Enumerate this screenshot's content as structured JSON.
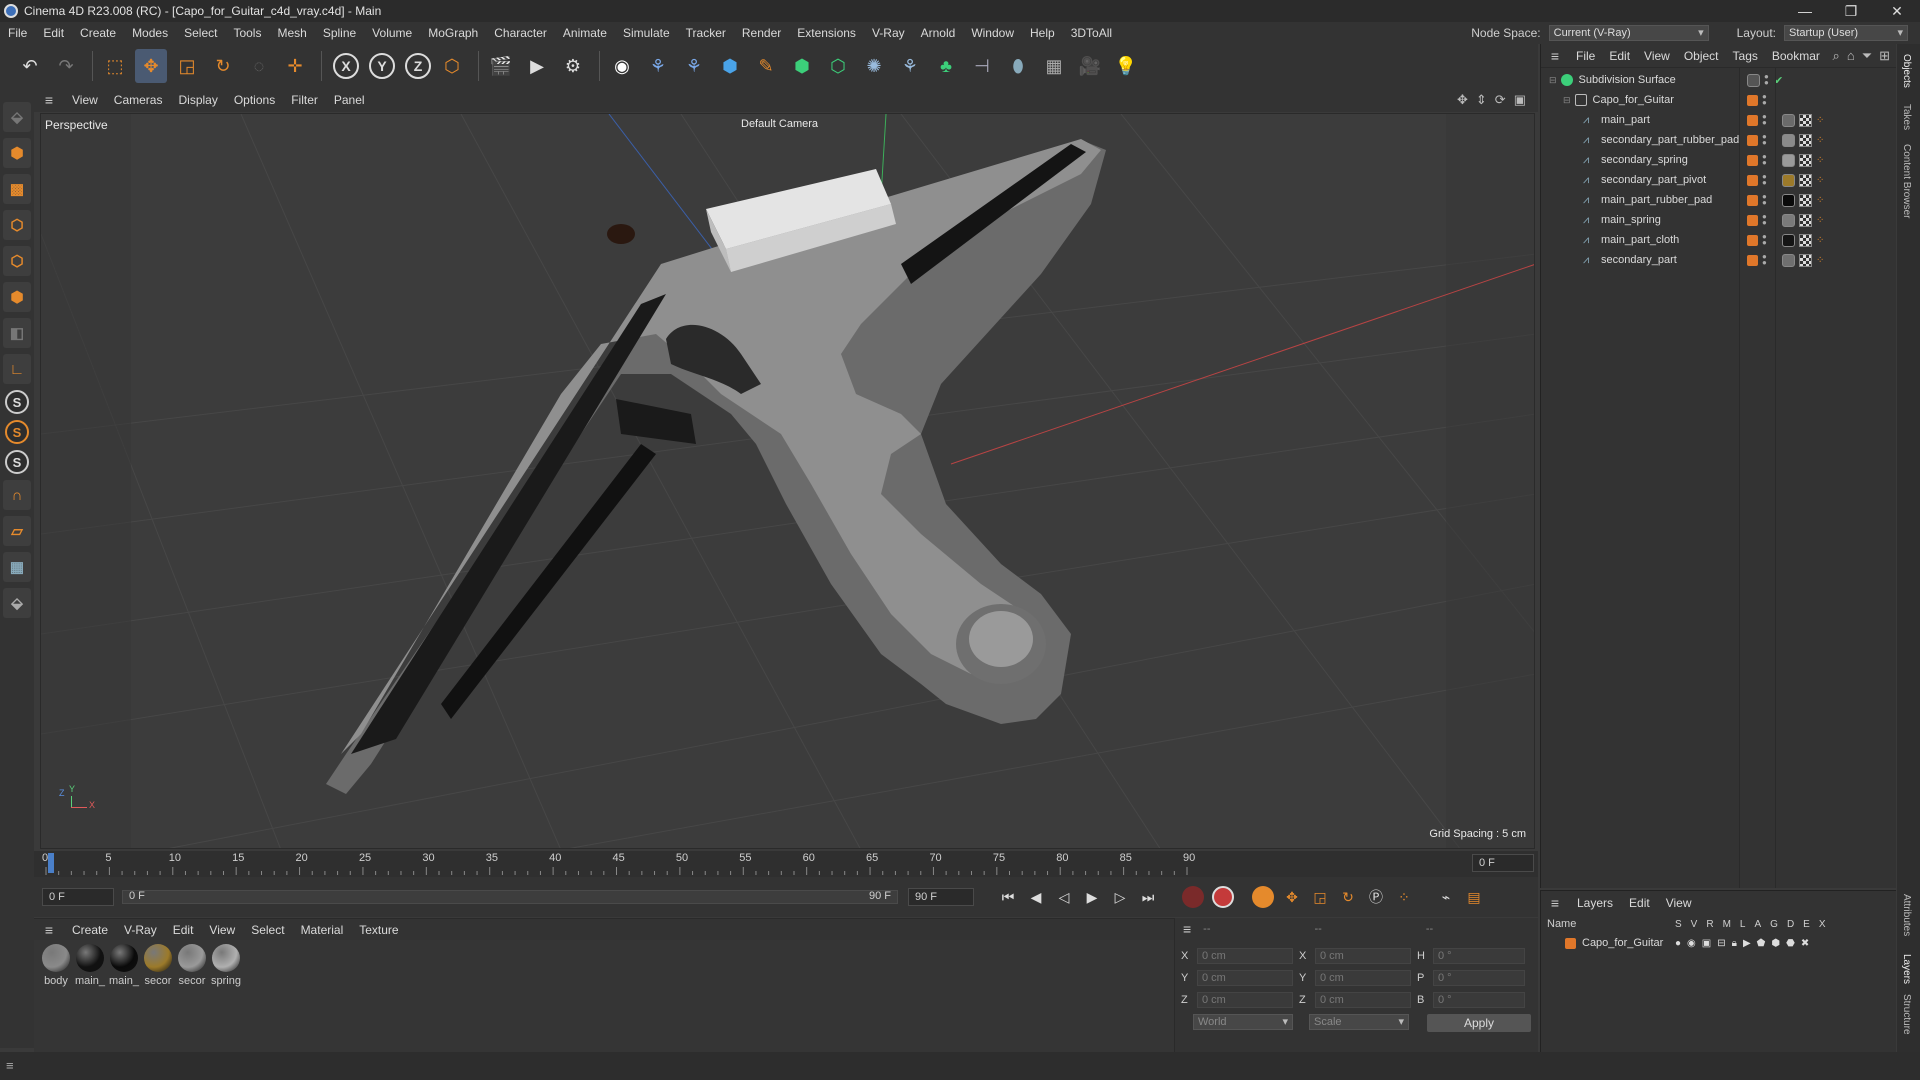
{
  "window": {
    "title": "Cinema 4D R23.008 (RC) - [Capo_for_Guitar_c4d_vray.c4d] - Main",
    "controls": [
      "—",
      "❐",
      "✕"
    ]
  },
  "menubar": {
    "items": [
      "File",
      "Edit",
      "Create",
      "Modes",
      "Select",
      "Tools",
      "Mesh",
      "Spline",
      "Volume",
      "MoGraph",
      "Character",
      "Animate",
      "Simulate",
      "Tracker",
      "Render",
      "Extensions",
      "V-Ray",
      "Arnold",
      "Window",
      "Help",
      "3DToAll"
    ],
    "node_space_label": "Node Space:",
    "node_space_value": "Current (V-Ray)",
    "layout_label": "Layout:",
    "layout_value": "Startup (User)"
  },
  "toolbar": {
    "x_label": "X",
    "y_label": "Y",
    "z_label": "Z"
  },
  "left_tools": {
    "s_label": "S"
  },
  "viewport": {
    "menu": [
      "View",
      "Cameras",
      "Display",
      "Options",
      "Filter",
      "Panel"
    ],
    "view_name": "Perspective",
    "camera_label": "Default Camera",
    "grid_spacing": "Grid Spacing : 5 cm",
    "axis_x": "X",
    "axis_y": "Y",
    "axis_z": "Z"
  },
  "timeline": {
    "ticks": [
      "0",
      "5",
      "10",
      "15",
      "20",
      "25",
      "30",
      "35",
      "40",
      "45",
      "50",
      "55",
      "60",
      "65",
      "70",
      "75",
      "80",
      "85",
      "90"
    ],
    "current_frame": "0 F"
  },
  "frame_controls": {
    "start": "0 F",
    "range_start": "0 F",
    "range_end": "90 F",
    "end": "90 F"
  },
  "material_manager": {
    "menu": [
      "Create",
      "V-Ray",
      "Edit",
      "View",
      "Select",
      "Material",
      "Texture"
    ],
    "materials": [
      {
        "label": "body",
        "color": "#8a8a8a"
      },
      {
        "label": "main_",
        "color": "#111111"
      },
      {
        "label": "main_",
        "color": "#0a0a0a"
      },
      {
        "label": "secor",
        "color": "#9c7a2a"
      },
      {
        "label": "secor",
        "color": "#9a9a9a"
      },
      {
        "label": "spring",
        "color": "#b0b0b0"
      }
    ]
  },
  "coordinates": {
    "header_a": "--",
    "header_b": "--",
    "header_c": "--",
    "rows": [
      {
        "a": "X",
        "av": "0 cm",
        "b": "X",
        "bv": "0 cm",
        "c": "H",
        "cv": "0 °"
      },
      {
        "a": "Y",
        "av": "0 cm",
        "b": "Y",
        "bv": "0 cm",
        "c": "P",
        "cv": "0 °"
      },
      {
        "a": "Z",
        "av": "0 cm",
        "b": "Z",
        "bv": "0 cm",
        "c": "B",
        "cv": "0 °"
      }
    ],
    "space": "World",
    "mode": "Scale",
    "apply_label": "Apply"
  },
  "object_manager": {
    "menu": [
      "File",
      "Edit",
      "View",
      "Object",
      "Tags",
      "Bookmar"
    ],
    "objects": [
      {
        "name": "Subdivision Surface",
        "level": 0
      },
      {
        "name": "Capo_for_Guitar",
        "level": 1
      },
      {
        "name": "main_part",
        "level": 2
      },
      {
        "name": "secondary_part_rubber_pad",
        "level": 2
      },
      {
        "name": "secondary_spring",
        "level": 2
      },
      {
        "name": "secondary_part_pivot",
        "level": 2
      },
      {
        "name": "main_part_rubber_pad",
        "level": 2
      },
      {
        "name": "main_spring",
        "level": 2
      },
      {
        "name": "main_part_cloth",
        "level": 2
      },
      {
        "name": "secondary_part",
        "level": 2
      }
    ]
  },
  "layer_manager": {
    "menu": [
      "Layers",
      "Edit",
      "View"
    ],
    "name_header": "Name",
    "columns": [
      "S",
      "V",
      "R",
      "M",
      "L",
      "A",
      "G",
      "D",
      "E",
      "X"
    ],
    "layer_name": "Capo_for_Guitar",
    "layer_color": "#e0772a"
  },
  "right_tabs": [
    "Objects",
    "Takes",
    "Content Browser",
    "Attributes",
    "Layers",
    "Structure"
  ]
}
